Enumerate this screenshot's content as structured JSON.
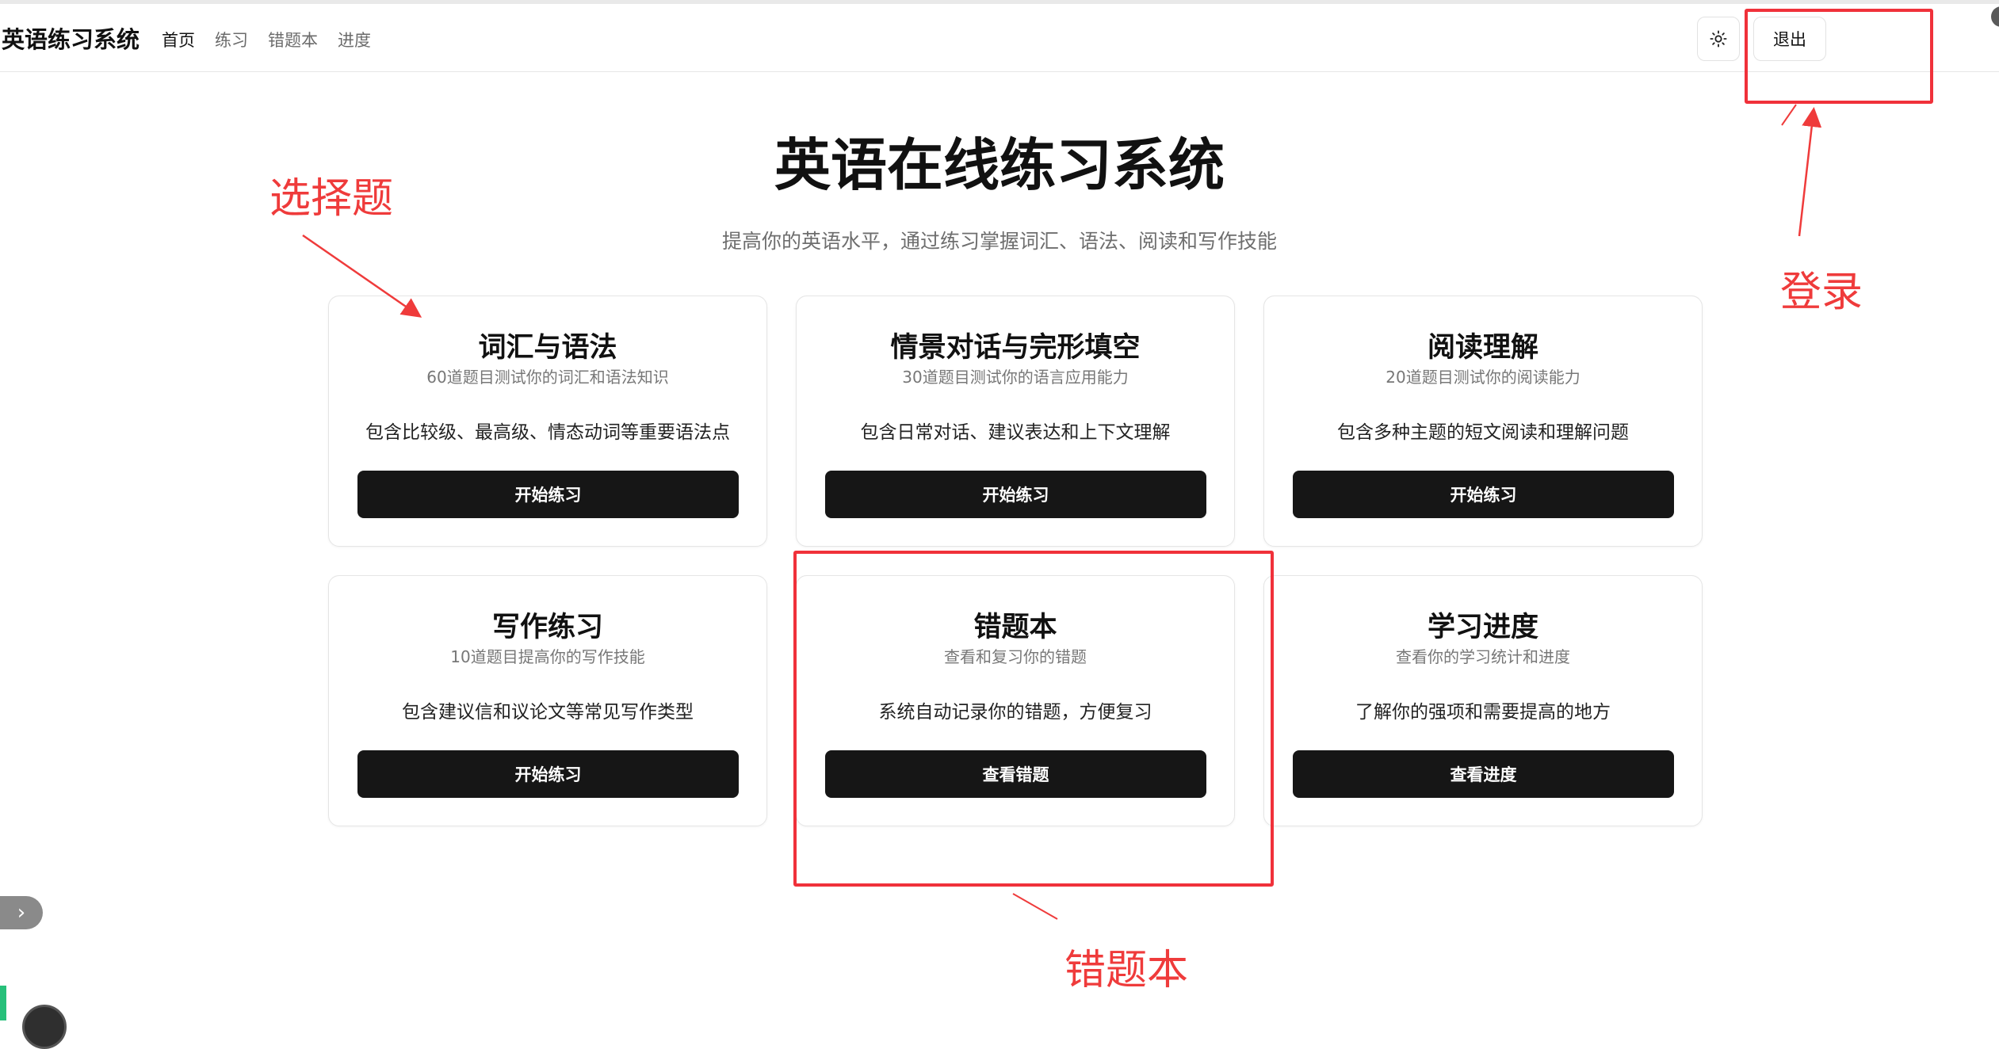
{
  "header": {
    "brand": "英语练习系统",
    "nav": [
      {
        "label": "首页"
      },
      {
        "label": "练习"
      },
      {
        "label": "错题本"
      },
      {
        "label": "进度"
      }
    ],
    "theme_icon": "sun-icon",
    "logout_label": "退出"
  },
  "hero": {
    "title": "英语在线练习系统",
    "subtitle": "提高你的英语水平，通过练习掌握词汇、语法、阅读和写作技能"
  },
  "cards": [
    {
      "title": "词汇与语法",
      "subtitle": "60道题目测试你的词汇和语法知识",
      "description": "包含比较级、最高级、情态动词等重要语法点",
      "button": "开始练习"
    },
    {
      "title": "情景对话与完形填空",
      "subtitle": "30道题目测试你的语言应用能力",
      "description": "包含日常对话、建议表达和上下文理解",
      "button": "开始练习"
    },
    {
      "title": "阅读理解",
      "subtitle": "20道题目测试你的阅读能力",
      "description": "包含多种主题的短文阅读和理解问题",
      "button": "开始练习"
    },
    {
      "title": "写作练习",
      "subtitle": "10道题目提高你的写作技能",
      "description": "包含建议信和议论文等常见写作类型",
      "button": "开始练习"
    },
    {
      "title": "错题本",
      "subtitle": "查看和复习你的错题",
      "description": "系统自动记录你的错题，方便复习",
      "button": "查看错题"
    },
    {
      "title": "学习进度",
      "subtitle": "查看你的学习统计和进度",
      "description": "了解你的强项和需要提高的地方",
      "button": "查看进度"
    }
  ],
  "annotations": {
    "choice": "选择题",
    "login": "登录",
    "mistakes": "错题本",
    "color": "#f0313a"
  },
  "side": {
    "toggle_icon": "chevron-right-icon",
    "toggle_glyph": "›"
  }
}
